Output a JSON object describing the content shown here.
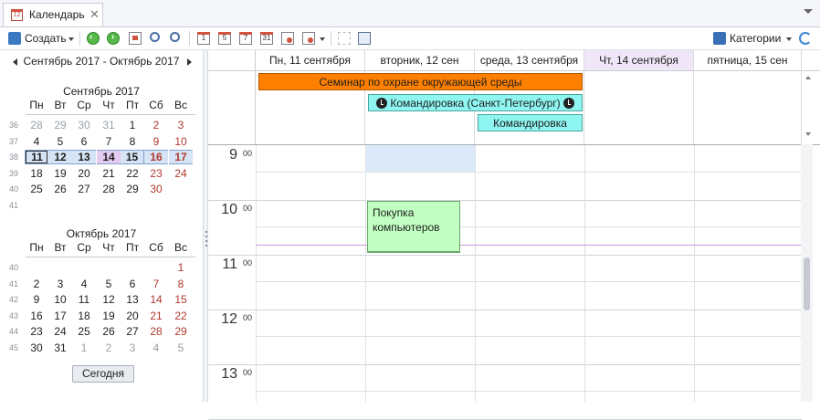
{
  "tab": {
    "title": "Календарь",
    "close": "✕",
    "icon_day": "12"
  },
  "toolbar": {
    "create_label": "Создать",
    "categories_label": "Категории",
    "day_icons": [
      "1",
      "5",
      "7",
      "31"
    ]
  },
  "navigator": {
    "range_label": "Сентябрь 2017 - Октябрь 2017",
    "weekdays": [
      "Пн",
      "Вт",
      "Ср",
      "Чт",
      "Пт",
      "Сб",
      "Вс"
    ],
    "months": [
      {
        "title": "Сентябрь 2017",
        "weeks": [
          {
            "num": "36",
            "days": [
              "28",
              "29",
              "30",
              "31",
              "1",
              "2",
              "3"
            ]
          },
          {
            "num": "37",
            "days": [
              "4",
              "5",
              "6",
              "7",
              "8",
              "9",
              "10"
            ]
          },
          {
            "num": "38",
            "days": [
              "11",
              "12",
              "13",
              "14",
              "15",
              "16",
              "17"
            ]
          },
          {
            "num": "39",
            "days": [
              "18",
              "19",
              "20",
              "21",
              "22",
              "23",
              "24"
            ]
          },
          {
            "num": "40",
            "days": [
              "25",
              "26",
              "27",
              "28",
              "29",
              "30",
              ""
            ]
          },
          {
            "num": "41",
            "days": [
              "",
              "",
              "",
              "",
              "",
              "",
              ""
            ]
          }
        ]
      },
      {
        "title": "Октябрь 2017",
        "weeks": [
          {
            "num": "40",
            "days": [
              "",
              "",
              "",
              "",
              "",
              "",
              "1"
            ]
          },
          {
            "num": "41",
            "days": [
              "2",
              "3",
              "4",
              "5",
              "6",
              "7",
              "8"
            ]
          },
          {
            "num": "42",
            "days": [
              "9",
              "10",
              "11",
              "12",
              "13",
              "14",
              "15"
            ]
          },
          {
            "num": "43",
            "days": [
              "16",
              "17",
              "18",
              "19",
              "20",
              "21",
              "22"
            ]
          },
          {
            "num": "44",
            "days": [
              "23",
              "24",
              "25",
              "26",
              "27",
              "28",
              "29"
            ]
          },
          {
            "num": "45",
            "days": [
              "30",
              "31",
              "1",
              "2",
              "3",
              "4",
              "5"
            ]
          }
        ]
      }
    ],
    "today_button": "Сегодня"
  },
  "columns": [
    "Пн, 11 сентября",
    "вторник, 12 сен",
    "среда, 13 сентября",
    "Чт, 14 сентября",
    "пятница, 15 сен"
  ],
  "all_day_events": [
    {
      "title": "Семинар по охране окружающей среды",
      "color": "#ff8000"
    },
    {
      "title": "Командировка (Санкт-Петербург)",
      "color": "#8ef5f0"
    },
    {
      "title": "Командировка",
      "color": "#8ef5f0"
    }
  ],
  "hours": [
    {
      "h": "9",
      "m": "00"
    },
    {
      "h": "10",
      "m": "00"
    },
    {
      "h": "11",
      "m": "00"
    },
    {
      "h": "12",
      "m": "00"
    },
    {
      "h": "13",
      "m": "00"
    }
  ],
  "appointments": [
    {
      "title": "Покупка компьютеров",
      "color": "#c2ffc2"
    }
  ]
}
